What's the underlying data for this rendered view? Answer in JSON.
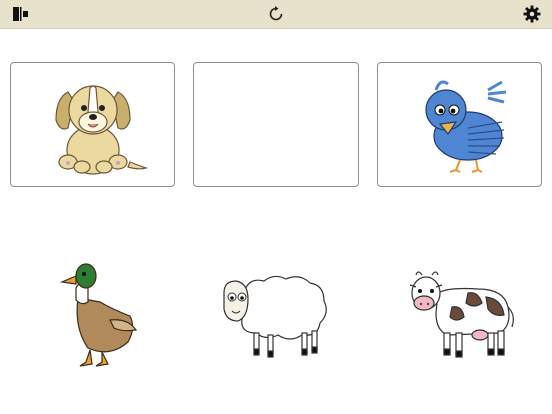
{
  "toolbar": {
    "left_icon": "exit-icon",
    "center_icon": "reload-icon",
    "right_icon": "gear-icon",
    "background": "#e6e2cb"
  },
  "target_cards": [
    {
      "slot": 1,
      "animal": "dog",
      "icon": "dog-icon"
    },
    {
      "slot": 2,
      "animal": null,
      "icon": null
    },
    {
      "slot": 3,
      "animal": "bird",
      "icon": "bird-icon"
    }
  ],
  "choices": [
    {
      "animal": "duck",
      "icon": "duck-icon"
    },
    {
      "animal": "sheep",
      "icon": "sheep-icon"
    },
    {
      "animal": "cow",
      "icon": "cow-icon"
    }
  ],
  "colors": {
    "dog_body": "#ecd9a0",
    "bird_body": "#4f86d3",
    "duck_head": "#2e7d32",
    "cow_spots": "#6b4a3a"
  }
}
